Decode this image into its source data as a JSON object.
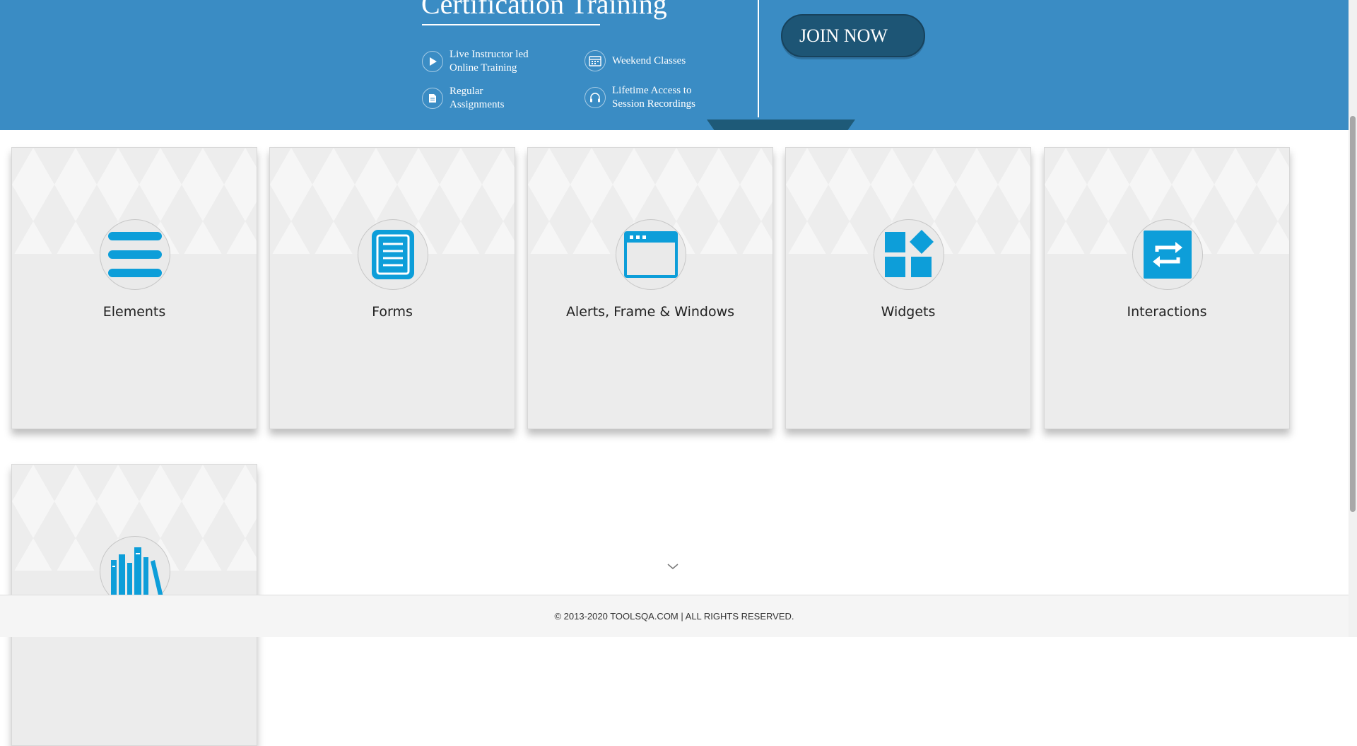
{
  "banner": {
    "title": "Certification Training",
    "features": [
      {
        "icon": "play-icon",
        "text": "Live Instructor led\nOnline Training"
      },
      {
        "icon": "calendar-icon",
        "text": "Weekend Classes"
      },
      {
        "icon": "document-icon",
        "text": "Regular\nAssignments"
      },
      {
        "icon": "headphones-icon",
        "text": "Lifetime Access to\nSession Recordings"
      }
    ],
    "join_label": "JOIN NOW"
  },
  "cards": [
    {
      "title": "Elements",
      "icon": "hamburger-menu-icon"
    },
    {
      "title": "Forms",
      "icon": "form-document-icon"
    },
    {
      "title": "Alerts, Frame & Windows",
      "icon": "browser-window-icon"
    },
    {
      "title": "Widgets",
      "icon": "widgets-grid-icon"
    },
    {
      "title": "Interactions",
      "icon": "swap-arrows-icon"
    },
    {
      "title": "",
      "icon": "books-icon"
    }
  ],
  "footer": {
    "text": "© 2013-2020 TOOLSQA.COM | ALL RIGHTS RESERVED."
  },
  "colors": {
    "banner": "#3a8cc4",
    "join_button": "#1d5575",
    "icon_blue": "#0d9ed9"
  }
}
